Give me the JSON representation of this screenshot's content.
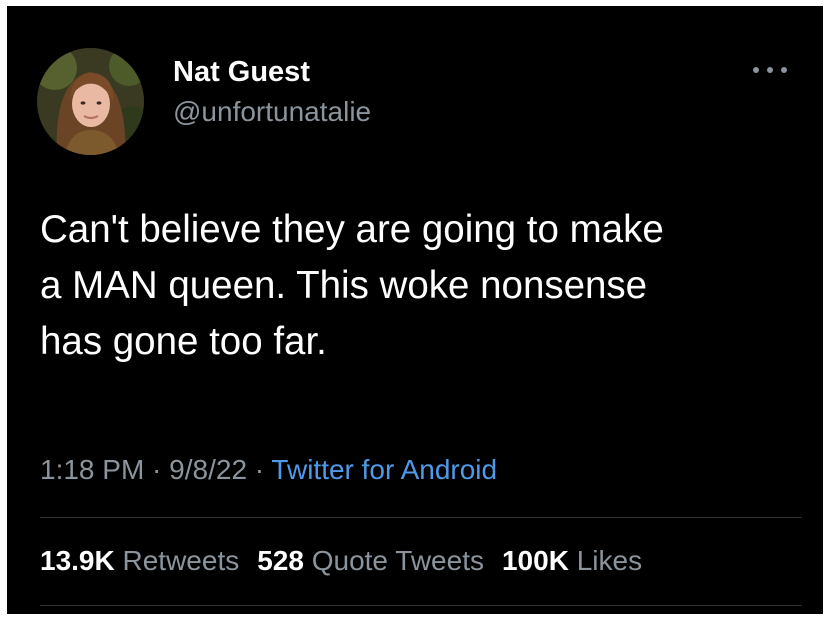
{
  "author": {
    "display_name": "Nat Guest",
    "handle": "@unfortunatalie",
    "avatar_icon": "profile-photo"
  },
  "more_icon": "ellipsis-icon",
  "tweet": {
    "lines": [
      "Can't believe they are going to make",
      "a MAN queen. This woke nonsense",
      "has gone too far."
    ]
  },
  "meta": {
    "time": "1:18 PM",
    "separator": " · ",
    "date": "9/8/22",
    "source": "Twitter for Android"
  },
  "stats": {
    "retweets_count": "13.9K",
    "retweets_label": "Retweets",
    "quotes_count": "528",
    "quotes_label": "Quote Tweets",
    "likes_count": "100K",
    "likes_label": "Likes"
  },
  "colors": {
    "background": "#000000",
    "text": "#ffffff",
    "secondary": "#8b949c",
    "link": "#4f9ae8"
  }
}
